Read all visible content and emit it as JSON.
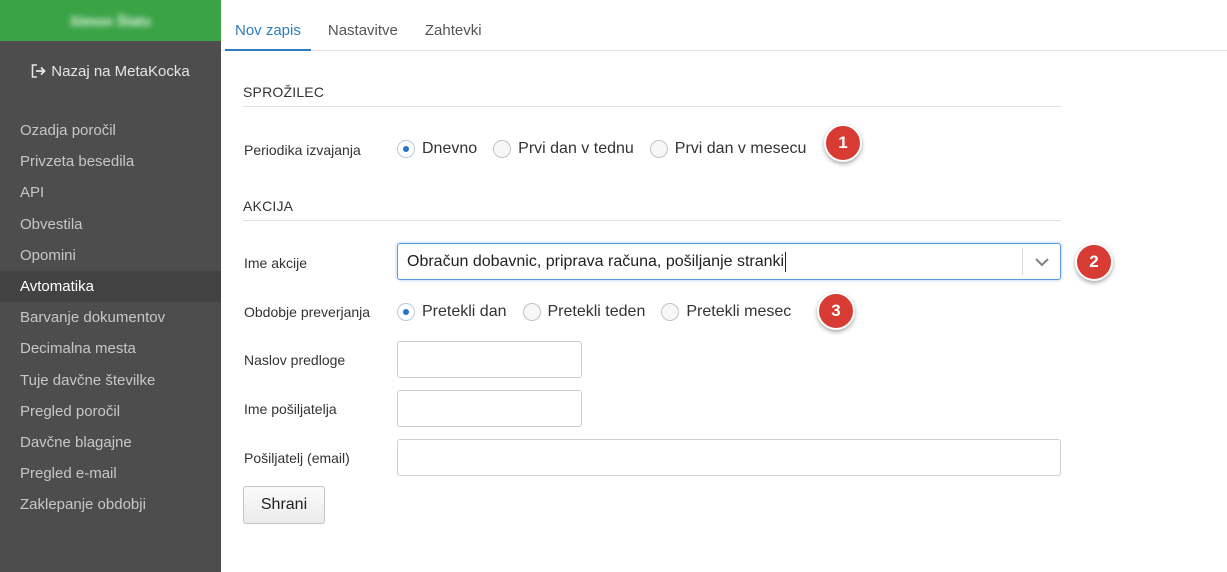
{
  "sidebar": {
    "header_title": "Simon Šlatu",
    "back_link": "Nazaj na MetaKocka",
    "items": [
      {
        "label": "Ozadja poročil"
      },
      {
        "label": "Privzeta besedila"
      },
      {
        "label": "API"
      },
      {
        "label": "Obvestila"
      },
      {
        "label": "Opomini"
      },
      {
        "label": "Avtomatika"
      },
      {
        "label": "Barvanje dokumentov"
      },
      {
        "label": "Decimalna mesta"
      },
      {
        "label": "Tuje davčne številke"
      },
      {
        "label": "Pregled poročil"
      },
      {
        "label": "Davčne blagajne"
      },
      {
        "label": "Pregled e-mail"
      },
      {
        "label": "Zaklepanje obdobji"
      }
    ],
    "active_item": "Avtomatika"
  },
  "tabs": [
    {
      "label": "Nov zapis",
      "active": true
    },
    {
      "label": "Nastavitve",
      "active": false
    },
    {
      "label": "Zahtevki",
      "active": false
    }
  ],
  "trigger": {
    "section_title": "SPROŽILEC",
    "periodika_label": "Periodika izvajanja",
    "options": [
      "Dnevno",
      "Prvi dan v tednu",
      "Prvi dan v mesecu"
    ],
    "selected": "Dnevno"
  },
  "action": {
    "section_title": "AKCIJA",
    "ime_akcije_label": "Ime akcije",
    "ime_akcije_value": "Obračun dobavnic, priprava računa, pošiljanje stranki",
    "obdobje_label": "Obdobje preverjanja",
    "obdobje_options": [
      "Pretekli dan",
      "Pretekli teden",
      "Pretekli mesec"
    ],
    "obdobje_selected": "Pretekli dan",
    "naslov_label": "Naslov predloge",
    "naslov_value": "",
    "posiljatelj_ime_label": "Ime pošiljatelja",
    "posiljatelj_ime_value": "",
    "posiljatelj_email_label": "Pošiljatelj (email)",
    "posiljatelj_email_value": "",
    "save_label": "Shrani"
  },
  "badges": [
    "1",
    "2",
    "3"
  ],
  "colors": {
    "sidebar_bg": "#4d4d4d",
    "sidebar_header": "#3aa346",
    "tab_active": "#2e7dbf",
    "badge": "#d83a34",
    "radio_dot": "#2a72d0"
  }
}
